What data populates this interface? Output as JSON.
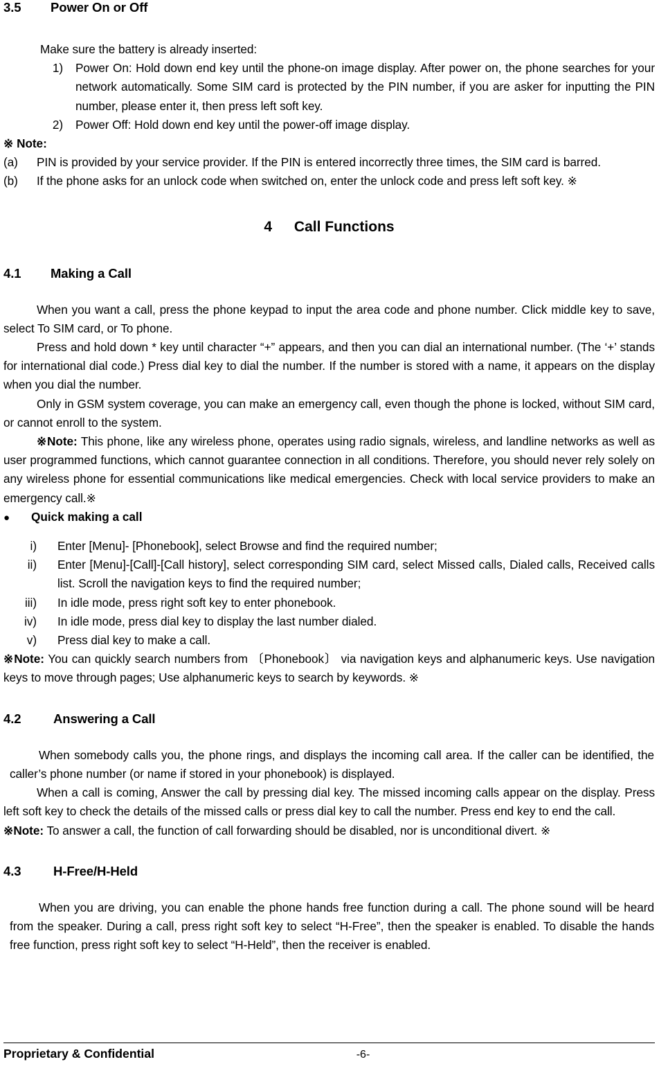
{
  "document": {
    "section_3_5": {
      "number": "3.5",
      "title": "Power On or Off",
      "intro": "Make sure the battery is already inserted:",
      "items": [
        {
          "marker": "1)",
          "text": "Power On: Hold down end key until the phone-on image display. After power on, the phone searches for your network automatically. Some SIM card is protected by the PIN number, if you are asker for inputting the PIN number, please enter it, then press left soft key."
        },
        {
          "marker": "2)",
          "text": "Power Off: Hold down end key until the power-off image display."
        }
      ],
      "note_label": "※ Note:",
      "note_items": [
        {
          "marker": "(a)",
          "text": "PIN is provided by your service provider. If the PIN is entered incorrectly three times, the SIM card is barred."
        },
        {
          "marker": "(b)",
          "text": "If the phone asks for an unlock code when switched on, enter the unlock code and press left soft key.  ※"
        }
      ]
    },
    "chapter_4": {
      "number": "4",
      "title": "Call Functions"
    },
    "section_4_1": {
      "number": "4.1",
      "title": "Making a Call",
      "para1": "When you want a call, press the phone keypad to input the area code and phone number. Click middle key to save, select To SIM card, or To phone.",
      "para2": "Press and hold down * key until character “+” appears, and then you can dial an international number. (The ‘+’ stands for international dial code.) Press dial key to dial the number. If the number is stored with a name, it appears on the display when you dial the number.",
      "para3": "Only in GSM system coverage, you can make an emergency call, even though the phone is locked, without SIM card, or cannot enroll to the system.",
      "note_prefix": "※Note:",
      "note_text": " This phone, like any wireless phone, operates using radio signals, wireless, and landline networks as well as user programmed functions, which cannot guarantee connection in all conditions. Therefore, you should never rely solely on any wireless phone for essential communications like medical emergencies. Check with local service providers to make an emergency call.※",
      "bullet_label": "Quick making a call",
      "bullet_glyph": "●",
      "steps": [
        {
          "marker": "i)",
          "text": "Enter [Menu]- [Phonebook], select Browse and find the required number;"
        },
        {
          "marker": "ii)",
          "text": "Enter [Menu]-[Call]-[Call history], select corresponding SIM card, select Missed calls, Dialed calls, Received calls list. Scroll the navigation keys to find the required number;"
        },
        {
          "marker": "iii)",
          "text": "In idle mode, press right soft key to enter phonebook."
        },
        {
          "marker": "iv)",
          "text": "In idle mode, press dial key to display the last number dialed."
        },
        {
          "marker": "v)",
          "text": "Press dial key to make a call."
        }
      ],
      "note2_prefix": "※Note:",
      "note2_text": " You can quickly search numbers from 〔Phonebook〕 via navigation keys and alphanumeric keys. Use navigation keys to move through pages; Use alphanumeric keys to search by keywords. ※"
    },
    "section_4_2": {
      "number": "4.2",
      "title": "Answering a Call",
      "para1": "When somebody calls you, the phone rings, and displays the incoming call area. If the caller can be identified, the caller’s phone number (or name if stored in your phonebook) is displayed.",
      "para2": "When a call is coming, Answer the call by pressing dial key. The missed incoming calls appear on the display. Press left soft key to check the details of the missed calls or press dial key to call the number. Press end key to end the call.",
      "note_prefix": "※Note:",
      "note_text": " To answer a call, the function of call forwarding should be disabled, nor is unconditional divert. ※"
    },
    "section_4_3": {
      "number": "4.3",
      "title": "H-Free/H-Held",
      "para1": "When you are driving, you can enable the phone hands free function during a call. The phone sound will be heard from the speaker. During a call, press right soft key to select “H-Free”, then the speaker is enabled. To disable the hands free function, press right soft key to select “H-Held”, then the receiver is enabled."
    }
  },
  "footer": {
    "left": "Proprietary & Confidential",
    "page": "-6-"
  },
  "colors": {
    "text": "#000000",
    "background": "#ffffff",
    "rule": "#000000"
  }
}
